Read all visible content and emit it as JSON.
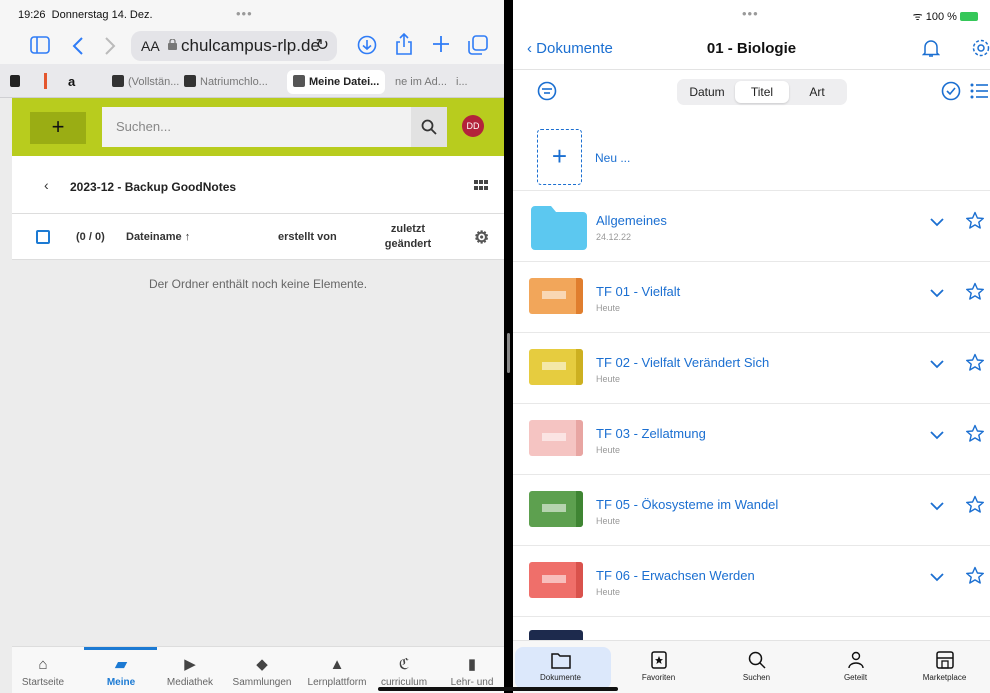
{
  "safari": {
    "time": "19:26",
    "date": "Donnerstag 14. Dez.",
    "text_size_label": "AA",
    "url": "chulcampus-rlp.de",
    "tabs": [
      {
        "label": "a"
      },
      {
        "label": "(Vollstän..."
      },
      {
        "label": "Natriumchlo..."
      },
      {
        "label": "Meine Datei..."
      },
      {
        "label": "ne im Ad..."
      },
      {
        "label": "i..."
      }
    ]
  },
  "schulcampus": {
    "add_label": "+",
    "search_placeholder": "Suchen...",
    "avatar_initials": "DD",
    "breadcrumb_title": "2023-12 - Backup GoodNotes",
    "table": {
      "count": "(0 / 0)",
      "col_name": "Dateiname ↑",
      "col_created_by": "erstellt von",
      "col_modified": "zuletzt geändert"
    },
    "empty_message": "Der Ordner enthält noch keine Elemente.",
    "bottom_nav": [
      {
        "label": "Startseite",
        "icon": "home-icon"
      },
      {
        "label": "Meine",
        "icon": "folder-icon",
        "active": true
      },
      {
        "label": "Mediathek",
        "icon": "play-icon"
      },
      {
        "label": "Sammlungen",
        "icon": "layers-icon"
      },
      {
        "label": "Lernplattform",
        "icon": "graduation-cap-icon"
      },
      {
        "label": "curriculum",
        "icon": "curriculum-icon"
      },
      {
        "label": "Lehr- und",
        "icon": "book-icon"
      }
    ]
  },
  "goodnotes": {
    "battery": "100 %",
    "back_label": "Dokumente",
    "title": "01 - Biologie",
    "sort_options": [
      "Datum",
      "Titel",
      "Art"
    ],
    "sort_selected": "Titel",
    "new_label": "Neu ...",
    "new_symbol": "+",
    "items": [
      {
        "name": "Allgemeines",
        "sub": "24.12.22",
        "type": "folder"
      },
      {
        "name": "TF 01 - Vielfalt",
        "sub": "Heute",
        "color": "#f2a65a",
        "spine": "#e07e2e"
      },
      {
        "name": "TF 02 - Vielfalt Verändert Sich",
        "sub": "Heute",
        "color": "#e6cc3f",
        "spine": "#cdb020"
      },
      {
        "name": "TF 03 - Zellatmung",
        "sub": "Heute",
        "color": "#f5c4c2",
        "spine": "#e8a5a2"
      },
      {
        "name": "TF 05 - Ökosysteme im Wandel",
        "sub": "Heute",
        "color": "#5da04f",
        "spine": "#3f8533"
      },
      {
        "name": "TF 06 - Erwachsen Werden",
        "sub": "Heute",
        "color": "#ef6f6a",
        "spine": "#d9524c"
      }
    ],
    "tabbar": [
      {
        "label": "Dokumente",
        "icon": "folder-icon",
        "active": true
      },
      {
        "label": "Favoriten",
        "icon": "bookmark-star-icon"
      },
      {
        "label": "Suchen",
        "icon": "search-icon"
      },
      {
        "label": "Geteilt",
        "icon": "shared-users-icon"
      },
      {
        "label": "Marketplace",
        "icon": "store-icon"
      }
    ]
  },
  "colors": {
    "schulcampus_green": "#b8cc1e",
    "accent_blue": "#1b6fd1",
    "folder_cyan": "#5cc8f0"
  }
}
